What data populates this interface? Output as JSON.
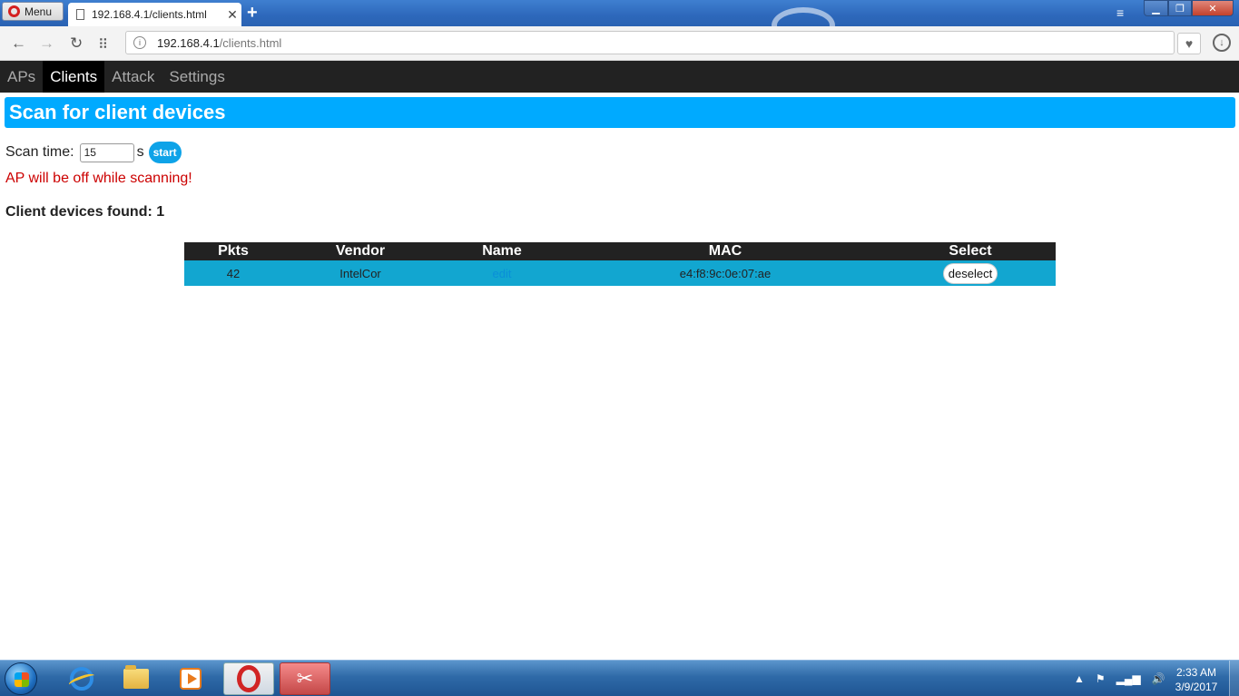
{
  "browser": {
    "menu_label": "Menu",
    "tab_title": "192.168.4.1/clients.html",
    "tab_close": "✕",
    "new_tab": "+",
    "url_host": "192.168.4.1",
    "url_path": "/clients.html",
    "icons": {
      "back": "←",
      "forward": "→",
      "reload": "↻",
      "speed_dial": "⠿",
      "site_info": "i",
      "heart": "♥",
      "download": "↓",
      "tabs_menu": "≡",
      "minimize": "▁",
      "maximize": "❐",
      "close": "✕"
    }
  },
  "nav": {
    "items": [
      {
        "label": "APs",
        "active": false
      },
      {
        "label": "Clients",
        "active": true
      },
      {
        "label": "Attack",
        "active": false
      },
      {
        "label": "Settings",
        "active": false
      }
    ]
  },
  "page": {
    "header": "Scan for client devices",
    "scan_time_label": "Scan time:",
    "scan_time_value": "15",
    "scan_time_unit": "s",
    "start_label": "start",
    "warning": "AP will be off while scanning!",
    "found_label": "Client devices found: 1"
  },
  "table": {
    "headers": [
      "Pkts",
      "Vendor",
      "Name",
      "MAC",
      "Select"
    ],
    "rows": [
      {
        "pkts": "42",
        "vendor": "IntelCor",
        "name": "edit",
        "mac": "e4:f8:9c:0e:07:ae",
        "select_label": "deselect"
      }
    ]
  },
  "taskbar": {
    "tray_arrow": "▲",
    "tray_flag": "⚑",
    "tray_signal": "▂▄▆",
    "tray_volume": "🔊",
    "time": "2:33 AM",
    "date": "3/9/2017"
  },
  "colors": {
    "header_blue": "#00aaff",
    "row_blue": "#12a6d0",
    "nav_dark": "#222222",
    "warning_red": "#cc0000"
  }
}
